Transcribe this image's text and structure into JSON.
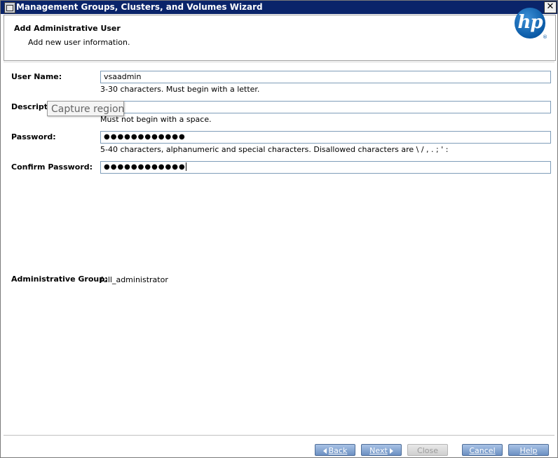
{
  "window": {
    "title": "Management Groups, Clusters, and Volumes Wizard",
    "close_glyph": "✕"
  },
  "header": {
    "title": "Add Administrative User",
    "subtitle": "Add new user information.",
    "logo_text": "hp",
    "logo_mark": "®"
  },
  "form": {
    "username": {
      "label": "User Name:",
      "value": "vsaadmin",
      "hint": "3-30 characters. Must begin with a letter."
    },
    "description": {
      "label": "Description:",
      "value": "",
      "hint": "Must not begin with a space."
    },
    "password": {
      "label": "Password:",
      "masked_value": "●●●●●●●●●●●●",
      "hint": "5-40 characters, alphanumeric and special characters. Disallowed characters are \\ / , . ; ' :"
    },
    "confirm_password": {
      "label": "Confirm Password:",
      "masked_value": "●●●●●●●●●●●●"
    },
    "admin_group": {
      "label": "Administrative Group:",
      "value": "full_administrator"
    }
  },
  "tooltip": {
    "text": "Capture region"
  },
  "buttons": {
    "back": "Back",
    "next": "Next",
    "close": "Close",
    "cancel": "Cancel",
    "help": "Help"
  },
  "colors": {
    "titlebar": "#0a246a",
    "button": "#6c90c2",
    "field_border": "#7f9db9",
    "logo": "#0a5aa6"
  }
}
